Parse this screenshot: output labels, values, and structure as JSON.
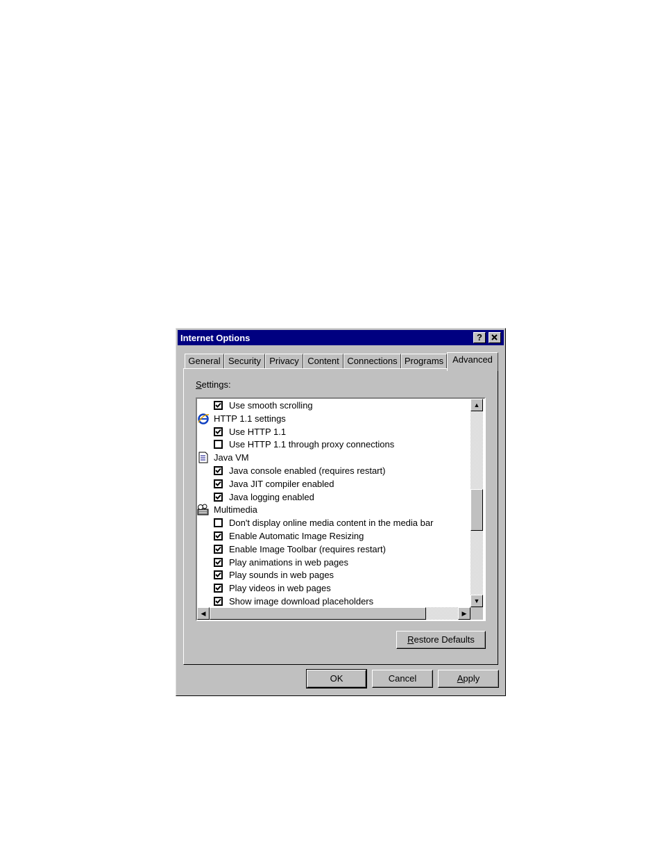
{
  "window": {
    "title": "Internet Options",
    "help_glyph": "?",
    "close_glyph": "✕"
  },
  "tabs": [
    {
      "label": "General"
    },
    {
      "label": "Security"
    },
    {
      "label": "Privacy"
    },
    {
      "label": "Content"
    },
    {
      "label": "Connections"
    },
    {
      "label": "Programs"
    },
    {
      "label": "Advanced",
      "active": true
    }
  ],
  "settings": {
    "label_first": "S",
    "label_rest": "ettings:",
    "items": [
      {
        "kind": "option",
        "label": "Use smooth scrolling",
        "checked": true
      },
      {
        "kind": "category",
        "label": "HTTP 1.1 settings",
        "icon": "ie-logo-icon"
      },
      {
        "kind": "option",
        "label": "Use HTTP 1.1",
        "checked": true
      },
      {
        "kind": "option",
        "label": "Use HTTP 1.1 through proxy connections",
        "checked": false
      },
      {
        "kind": "category",
        "label": "Java VM",
        "icon": "document-icon"
      },
      {
        "kind": "option",
        "label": "Java console enabled (requires restart)",
        "checked": true
      },
      {
        "kind": "option",
        "label": "Java JIT compiler enabled",
        "checked": true
      },
      {
        "kind": "option",
        "label": "Java logging enabled",
        "checked": true
      },
      {
        "kind": "category",
        "label": "Multimedia",
        "icon": "multimedia-icon"
      },
      {
        "kind": "option",
        "label": "Don't display online media content in the media bar",
        "checked": false
      },
      {
        "kind": "option",
        "label": "Enable Automatic Image Resizing",
        "checked": true
      },
      {
        "kind": "option",
        "label": "Enable Image Toolbar (requires restart)",
        "checked": true
      },
      {
        "kind": "option",
        "label": "Play animations in web pages",
        "checked": true
      },
      {
        "kind": "option",
        "label": "Play sounds in web pages",
        "checked": true
      },
      {
        "kind": "option",
        "label": "Play videos in web pages",
        "checked": true
      },
      {
        "kind": "option",
        "label": "Show image download placeholders",
        "checked": true
      }
    ]
  },
  "buttons": {
    "restore_first": "R",
    "restore_rest": "estore Defaults",
    "ok": "OK",
    "cancel": "Cancel",
    "apply_first": "A",
    "apply_rest": "pply"
  },
  "scroll": {
    "vertical_fraction": 0.55,
    "horizontal_fraction": 0.0
  }
}
